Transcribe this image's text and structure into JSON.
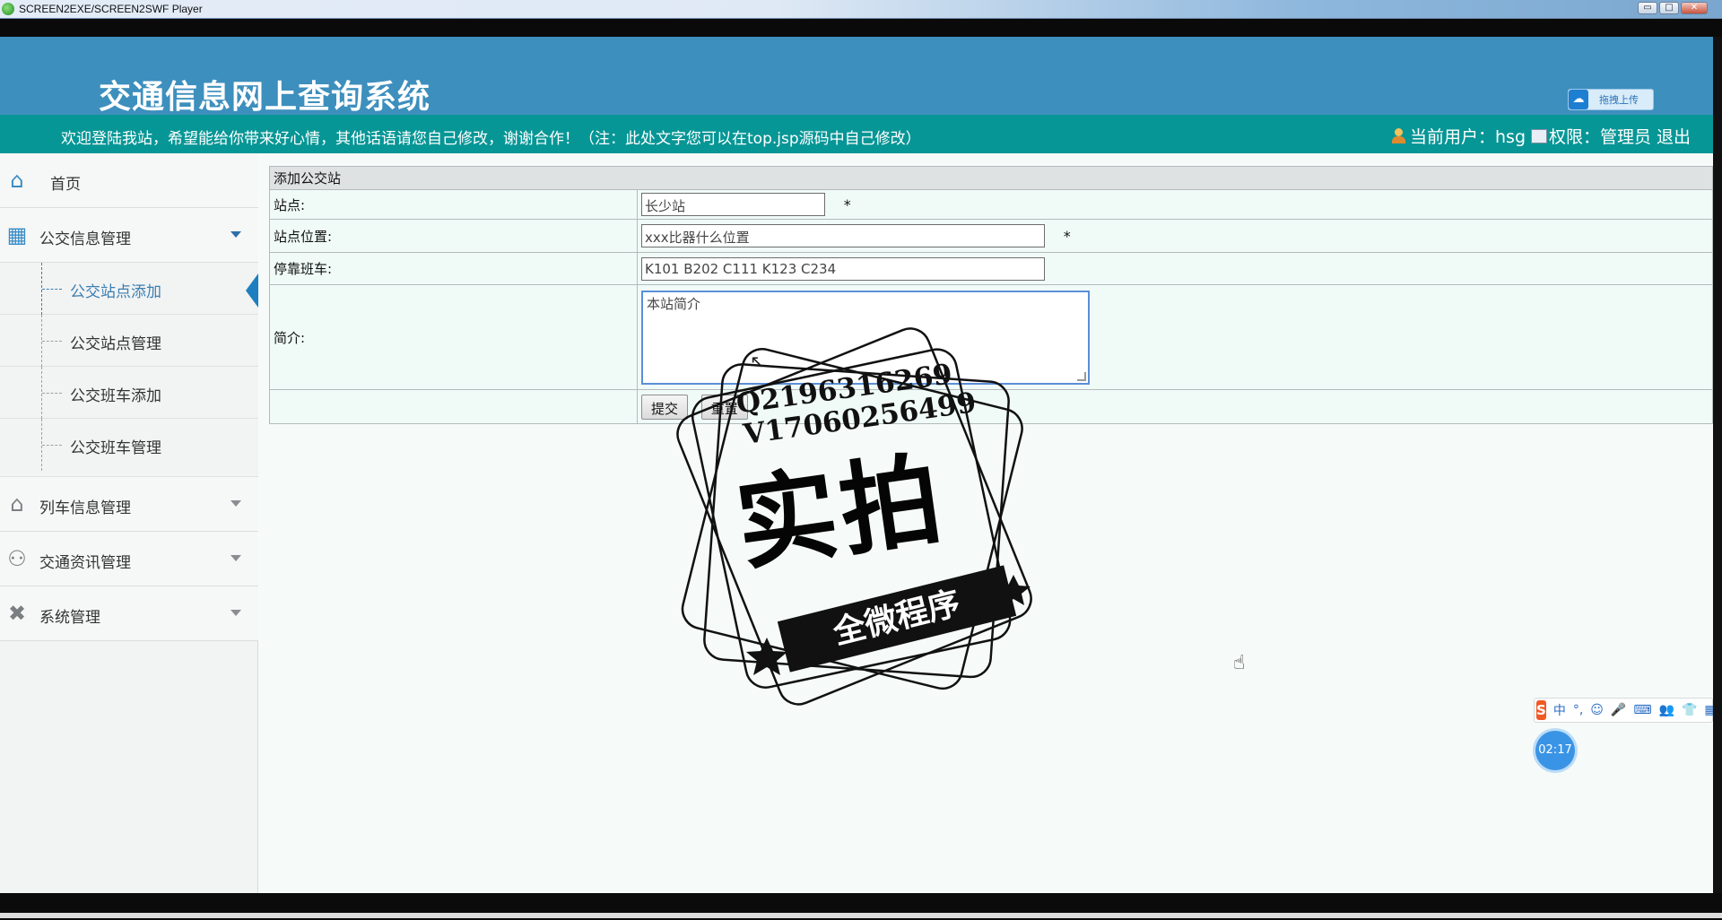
{
  "player": {
    "title": "SCREEN2EXE/SCREEN2SWF Player",
    "minimize": "▭",
    "maximize": "□",
    "close": "✕"
  },
  "header": {
    "system_title": "交通信息网上查询系统"
  },
  "notice_bar": {
    "notice": "欢迎登陆我站，希望能给你带来好心情，其他话语请您自己修改，谢谢合作！（注：此处文字您可以在top.jsp源码中自己修改）",
    "current_user_label": "当前用户：hsg",
    "role_label": "权限：管理员",
    "logout": "退出"
  },
  "upload_widget": {
    "label": "拖拽上传"
  },
  "sidebar": {
    "home": "首页",
    "bus_group": "公交信息管理",
    "bus_items": [
      "公交站点添加",
      "公交站点管理",
      "公交班车添加",
      "公交班车管理"
    ],
    "train_group": "列车信息管理",
    "news_group": "交通资讯管理",
    "system_group": "系统管理"
  },
  "form": {
    "caption": "添加公交站",
    "station_label": "站点:",
    "station_value": "长少站",
    "location_label": "站点位置:",
    "location_value": "xxx比器什么位置",
    "buses_label": "停靠班车:",
    "buses_value": "K101  B202 C111 K123  C234",
    "intro_label": "简介:",
    "intro_value": "本站简介",
    "required_mark": "*",
    "submit": "提交",
    "reset": "重置"
  },
  "watermark": {
    "qq": "Q2196316269",
    "wechat": "V17060256499",
    "main": "实拍",
    "ribbon": "全微程序"
  },
  "ime": {
    "logo": "S",
    "lang": "中",
    "punct": "°,",
    "items": [
      "☺",
      "🎤",
      "⌨",
      "👥",
      "👕",
      "▦"
    ]
  },
  "timer": "02:17",
  "icons": {
    "home": "home-icon",
    "bus": "grid-icon",
    "train": "house-icon",
    "news": "users-icon",
    "system": "wrench-icon"
  },
  "colors": {
    "header": "#3d8fbd",
    "notice_bar": "#079696",
    "accent": "#1d7fc0"
  }
}
